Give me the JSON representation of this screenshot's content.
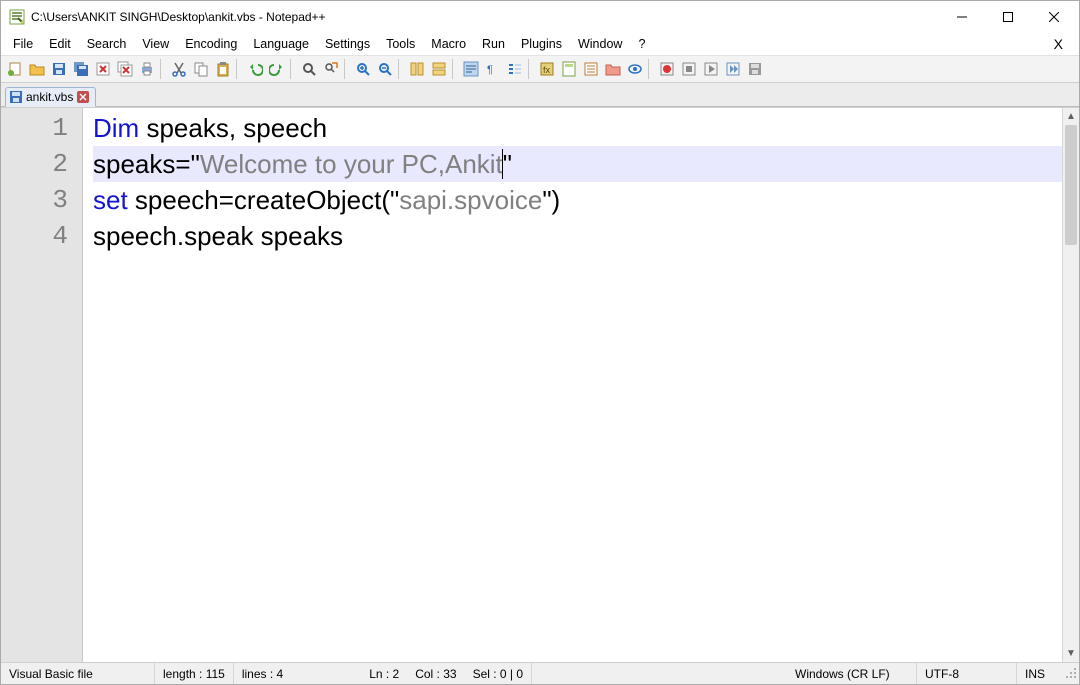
{
  "title": "C:\\Users\\ANKIT SINGH\\Desktop\\ankit.vbs - Notepad++",
  "menus": [
    "File",
    "Edit",
    "Search",
    "View",
    "Encoding",
    "Language",
    "Settings",
    "Tools",
    "Macro",
    "Run",
    "Plugins",
    "Window",
    "?"
  ],
  "toolbar_icons": [
    "new",
    "open",
    "save",
    "save-all",
    "close",
    "close-all",
    "print",
    "",
    "cut",
    "copy",
    "paste",
    "",
    "undo",
    "redo",
    "",
    "find",
    "replace",
    "",
    "zoom-in",
    "zoom-out",
    "",
    "sync-v",
    "sync-h",
    "",
    "word-wrap",
    "show-all",
    "indent-guide",
    "",
    "lang",
    "doc-map",
    "func-list",
    "folder",
    "monitor",
    "",
    "record",
    "stop",
    "play",
    "play-multi",
    "save-macro"
  ],
  "tab": {
    "label": "ankit.vbs"
  },
  "code": {
    "lines": [
      {
        "n": "1",
        "segments": [
          {
            "t": "Dim",
            "c": "kw"
          },
          {
            "t": " speaks, speech",
            "c": ""
          }
        ]
      },
      {
        "n": "2",
        "current": true,
        "segments": [
          {
            "t": "speaks=",
            "c": ""
          },
          {
            "t": "\"",
            "c": "quote"
          },
          {
            "t": "Welcome to your PC,Ankit",
            "c": "str",
            "caret_after": true
          },
          {
            "t": "\"",
            "c": "quote"
          }
        ]
      },
      {
        "n": "3",
        "segments": [
          {
            "t": "set",
            "c": "kw"
          },
          {
            "t": " speech=createObject(",
            "c": ""
          },
          {
            "t": "\"",
            "c": "quote"
          },
          {
            "t": "sapi.spvoice",
            "c": "str"
          },
          {
            "t": "\"",
            "c": "quote"
          },
          {
            "t": ")",
            "c": ""
          }
        ]
      },
      {
        "n": "4",
        "segments": [
          {
            "t": "speech.speak speaks",
            "c": ""
          }
        ]
      }
    ]
  },
  "status": {
    "filetype": "Visual Basic file",
    "length": "length : 115",
    "lines": "lines : 4",
    "pos_ln": "Ln : 2",
    "pos_col": "Col : 33",
    "pos_sel": "Sel : 0 | 0",
    "eol": "Windows (CR LF)",
    "encoding": "UTF-8",
    "mode": "INS"
  }
}
